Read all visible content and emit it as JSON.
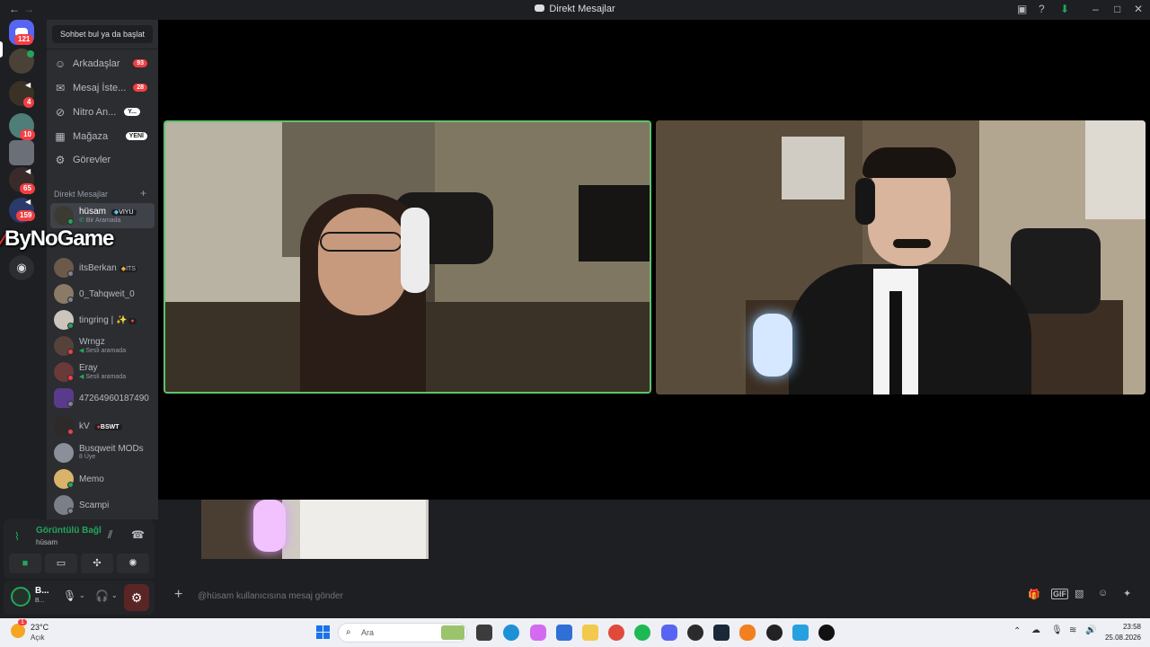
{
  "window": {
    "title": "Direkt Mesajlar",
    "back_icon": "arrow-left-icon",
    "forward_icon": "arrow-right-icon"
  },
  "servers": {
    "home_badge": "121",
    "items": [
      {
        "badge": ""
      },
      {
        "badge": "4"
      },
      {
        "badge": "10"
      },
      {
        "badge": ""
      },
      {
        "badge": "65"
      },
      {
        "badge": "159"
      }
    ]
  },
  "overlay_logo": "ByNoGame",
  "sidebar": {
    "search_label": "Sohbet bul ya da başlat",
    "nav": [
      {
        "label": "Arkadaşlar",
        "badge": "93",
        "icon": "friends-icon"
      },
      {
        "label": "Mesaj İste...",
        "badge": "28",
        "icon": "mail-icon"
      },
      {
        "label": "Nitro An...",
        "badge": "Y...",
        "icon": "nitro-icon"
      },
      {
        "label": "Mağaza",
        "badge": "YENİ",
        "icon": "shop-icon"
      },
      {
        "label": "Görevler",
        "badge": "",
        "icon": "quests-icon"
      }
    ],
    "dm_header": "Direkt Mesajlar",
    "add_dm": "+",
    "dms": [
      {
        "name": "hüsam",
        "tag": "VIYU",
        "sub": "Bir Aramada",
        "status": "#23a55a"
      },
      {
        "name": "itsBerkan",
        "tag": "ITS",
        "sub": "",
        "status": "#80848e"
      },
      {
        "name": "0_Tahqweit_0",
        "tag": "",
        "sub": "",
        "status": "#80848e"
      },
      {
        "name": "tingring | ✨",
        "tag": "",
        "sub": "",
        "status": "#23a55a"
      },
      {
        "name": "Wrngz",
        "tag": "",
        "sub": "Sesli aramada",
        "status": "#f23f43"
      },
      {
        "name": "Eray",
        "tag": "",
        "sub": "Sesli aramada",
        "status": "#f23f43"
      },
      {
        "name": "47264960187490",
        "tag": "",
        "sub": "",
        "status": "#80848e"
      },
      {
        "name": "kV",
        "tag": "BSWT",
        "sub": "",
        "status": "#f23f43"
      },
      {
        "name": "Busqweit MODs",
        "tag": "",
        "sub": "8 Üye",
        "status": ""
      },
      {
        "name": "Memo",
        "tag": "",
        "sub": "",
        "status": "#23a55a"
      },
      {
        "name": "Scampi",
        "tag": "",
        "sub": "",
        "status": "#80848e"
      }
    ]
  },
  "voice_panel": {
    "status": "Görüntülü Bağl",
    "channel": "hüsam"
  },
  "user_panel": {
    "name": "B...",
    "sub": "B..."
  },
  "message_input": {
    "placeholder": "@hüsam kullanıcısına mesaj gönder"
  },
  "taskbar": {
    "weather_temp": "23°C",
    "weather_desc": "Açık",
    "weather_badge": "1",
    "search_label": "Ara",
    "time": "23:58",
    "date": "25.08.2026"
  },
  "colors": {
    "speaking_border": "#5ec36a",
    "discord_blurple": "#5865f2",
    "badge_red": "#f23f43",
    "online_green": "#23a55a"
  }
}
